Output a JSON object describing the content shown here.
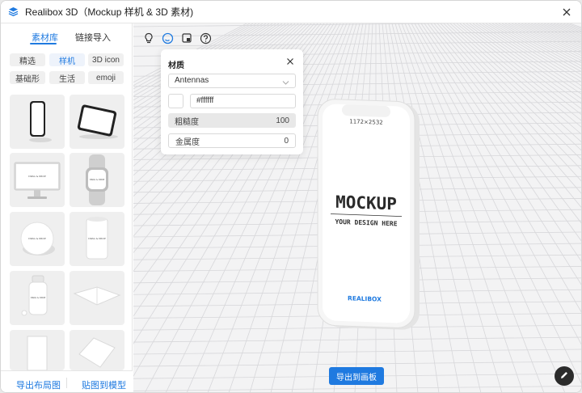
{
  "window": {
    "title": "Realibox 3D（Mockup 样机 & 3D 素材)"
  },
  "sidebar": {
    "tabs": [
      {
        "label": "素材库"
      },
      {
        "label": "链接导入"
      }
    ],
    "categories": [
      {
        "label": "精选"
      },
      {
        "label": "样机"
      },
      {
        "label": "3D icon"
      },
      {
        "label": "基础形"
      },
      {
        "label": "生活"
      },
      {
        "label": "emoji"
      }
    ],
    "thumb_labels": {
      "monitor": "DRAG & DROP",
      "watch": "DRAG & DROP",
      "disc": "DRAG & DROP",
      "can": "DRAG & DROP",
      "bottle": "DRAG & DROP"
    },
    "footer": {
      "left_label": "导出布局图",
      "right_label": "贴图到模型"
    }
  },
  "toolbar": {
    "icons": [
      "light-icon",
      "material-icon",
      "texture-icon",
      "help-icon"
    ]
  },
  "material_panel": {
    "title": "材质",
    "selected_part": "Antennas",
    "color_hex": "#ffffff",
    "roughness_label": "粗糙度",
    "roughness_value": "100",
    "metalness_label": "金属度",
    "metalness_value": "0"
  },
  "phone": {
    "resolution": "1172×2532",
    "headline": "MOCKUP",
    "tagline": "YOUR DESIGN HERE",
    "brand": "REALIBOX"
  },
  "actions": {
    "export_label": "导出到画板"
  },
  "colors": {
    "accent": "#1f7ae0",
    "fab": "#2b2b2b"
  }
}
